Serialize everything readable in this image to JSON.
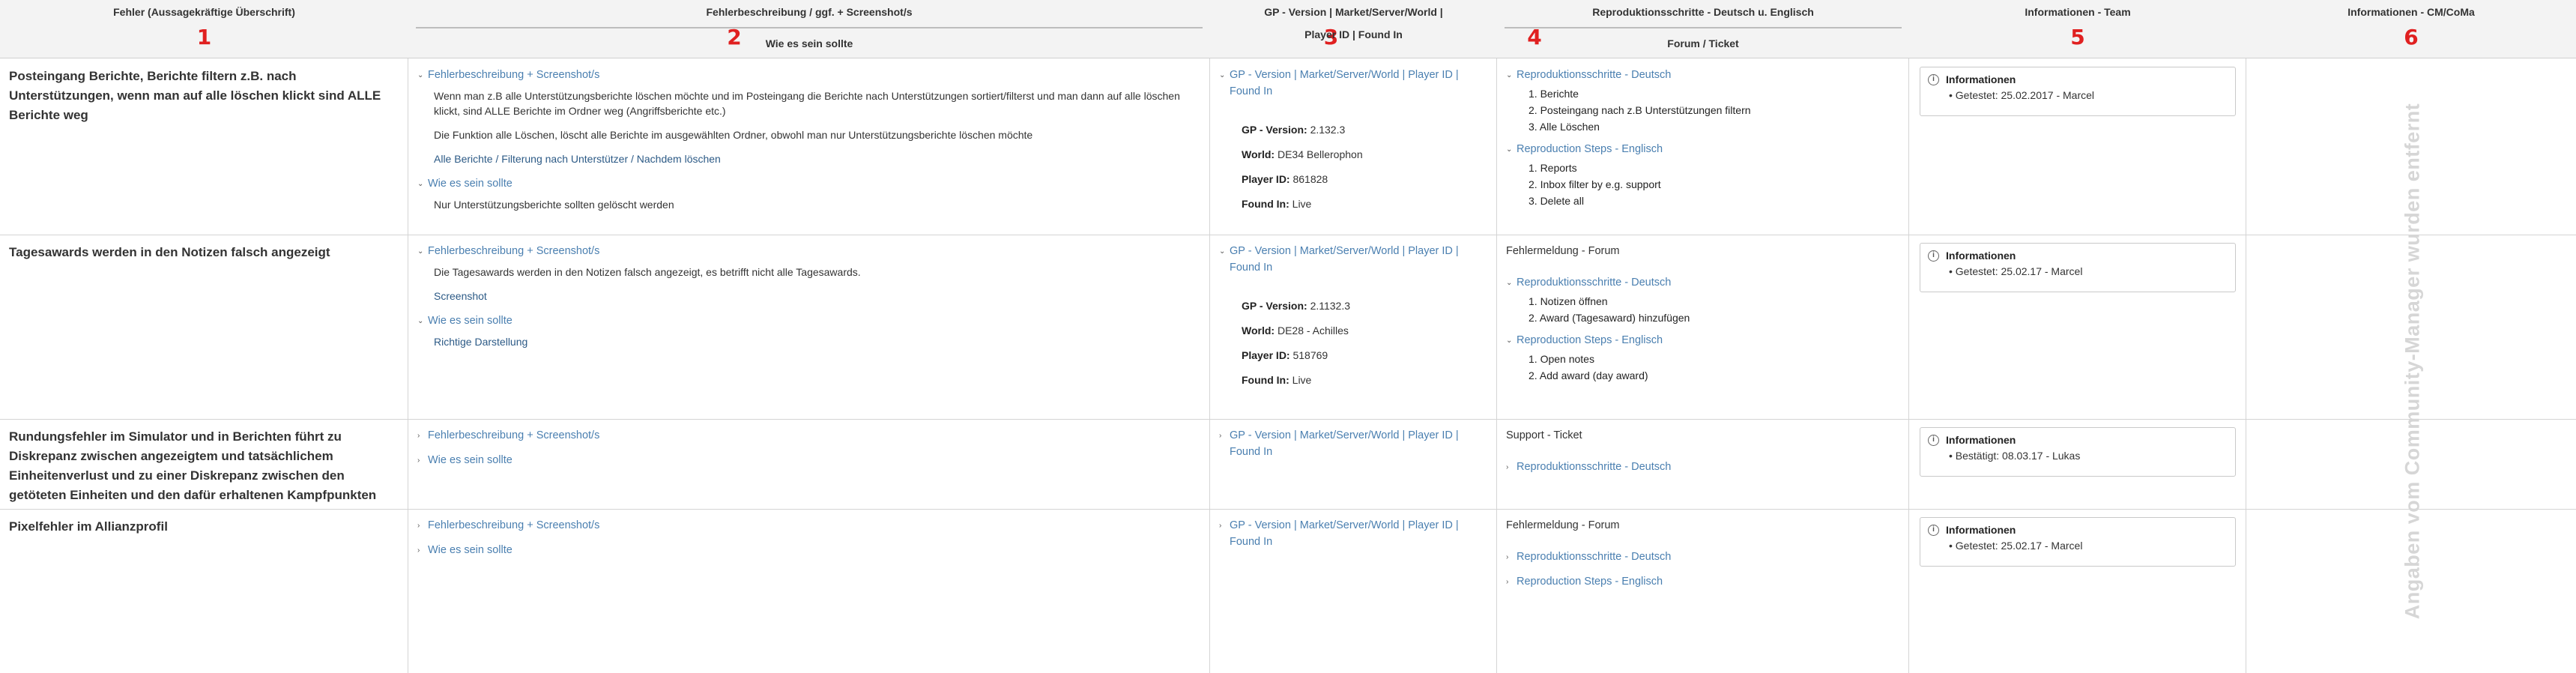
{
  "header": {
    "col1": {
      "title": "Fehler (Aussagekräftige Überschrift)",
      "num": "1"
    },
    "col2": {
      "title": "Fehlerbeschreibung / ggf. + Screenshot/s",
      "sub": "Wie es sein sollte",
      "num": "2"
    },
    "col3": {
      "title": "GP - Version | Market/Server/World |",
      "sub": "Player ID | Found In",
      "num": "3"
    },
    "col4": {
      "title": "Reproduktionsschritte - Deutsch u. Englisch",
      "sub": "Forum / Ticket",
      "num": "4"
    },
    "col5": {
      "title": "Informationen - Team",
      "num": "5"
    },
    "col6": {
      "title": "Informationen - CM/CoMa",
      "num": "6"
    }
  },
  "labels": {
    "desc": "Fehlerbeschreibung + Screenshot/s",
    "should": "Wie es sein sollte",
    "gp_line1": "GP - Version | Market/Server/World | Player ID |",
    "gp_line2": "Found In",
    "gp_version": "GP - Version:",
    "world": "World:",
    "player_id": "Player ID:",
    "found_in": "Found In:",
    "repro_de": "Reproduktionsschritte - Deutsch",
    "repro_en": "Reproduction Steps - Englisch",
    "info": "Informationen",
    "info_icon": "i"
  },
  "rows": [
    {
      "title": "Posteingang Berichte,  Berichte filtern z.B. nach Unterstützungen, wenn man auf alle löschen klickt sind ALLE Berichte weg",
      "desc_text1": "Wenn man z.B  alle Unterstützungsberichte löschen möchte und im Posteingang die Berichte nach Unterstützungen sortiert/filterst und man dann auf alle löschen klickt, sind ALLE Berichte im Ordner weg (Angriffsberichte etc.)",
      "desc_text2": "Die Funktion alle Löschen, löscht alle Berichte im ausgewählten Ordner, obwohl man nur Unterstützungsberichte löschen möchte",
      "desc_link": "Alle Berichte / Filterung nach Unterstützer / Nachdem löschen",
      "should_text": "Nur Unterstützungsberichte sollten gelöscht werden",
      "gp_version": "2.132.3",
      "world": "DE34 Bellerophon",
      "player_id": "861828",
      "found_in": "Live",
      "steps_de": [
        "1. Berichte",
        "2. Posteingang nach z.B Unterstützungen filtern",
        "3. Alle Löschen"
      ],
      "steps_en": [
        "1. Reports",
        "2. Inbox filter by e.g. support",
        "3. Delete all"
      ],
      "info": "Getestet: 25.02.2017 - Marcel"
    },
    {
      "title": "Tagesawards werden in den Notizen falsch angezeigt",
      "desc_text1": "Die Tagesawards werden in den Notizen falsch angezeigt, es betrifft nicht alle Tagesawards.",
      "desc_link": "Screenshot",
      "should_text": "Richtige Darstellung",
      "gp_version": "2.1132.3",
      "world": "DE28 - Achilles",
      "player_id": "518769",
      "found_in": "Live",
      "forum": "Fehlermeldung - Forum",
      "steps_de": [
        "1. Notizen öffnen",
        "2.  Award (Tagesaward) hinzufügen"
      ],
      "steps_en": [
        "1. Open notes",
        "2. Add award (day award)"
      ],
      "info": "Getestet: 25.02.17 - Marcel"
    },
    {
      "title": "Rundungsfehler im Simulator und in Berichten führt zu Diskrepanz zwischen angezeigtem und tatsächlichem Einheitenverlust und zu einer Diskrepanz zwischen den getöteten Einheiten und den dafür erhaltenen Kampfpunkten",
      "forum": "Support - Ticket",
      "info": "Bestätigt: 08.03.17 - Lukas"
    },
    {
      "title": "Pixelfehler im Allianzprofil",
      "forum": "Fehlermeldung - Forum",
      "info": "Getestet: 25.02.17 - Marcel"
    }
  ],
  "side_note": "Angaben vom Community-Manager wurden entfernt",
  "colors": {
    "accent": "#4a7fb0",
    "number_red": "#e02020",
    "header_bg": "#f3f3f3"
  }
}
